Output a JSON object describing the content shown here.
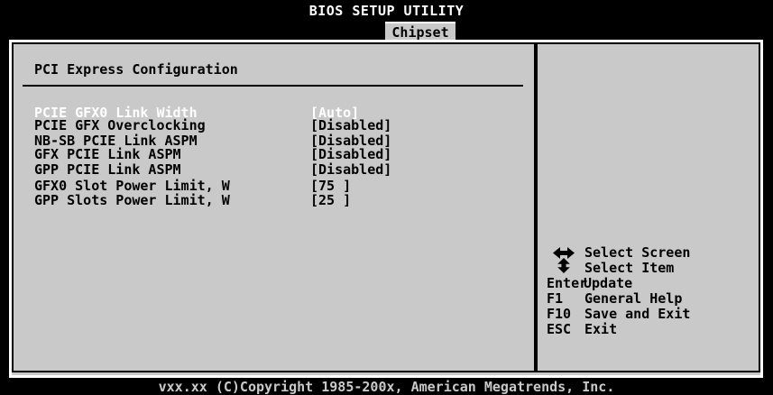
{
  "header": {
    "app_title": "BIOS SETUP UTILITY",
    "active_tab": "Chipset"
  },
  "main": {
    "section_title": "PCI Express Configuration",
    "options": [
      {
        "label": "PCIE GFX0 Link Width",
        "value": "[Auto]",
        "selected": true
      },
      {
        "label": "PCIE GFX Overclocking",
        "value": "[Disabled]",
        "selected": false
      },
      {
        "label": "NB-SB PCIE Link ASPM",
        "value": "[Disabled]",
        "selected": false
      },
      {
        "label": "GFX PCIE Link ASPM",
        "value": "[Disabled]",
        "selected": false
      },
      {
        "label": "GPP PCIE Link ASPM",
        "value": "[Disabled]",
        "selected": false
      },
      {
        "label": "GFX0 Slot Power Limit, W",
        "value": "[75 ]",
        "selected": false
      },
      {
        "label": "GPP Slots Power Limit, W",
        "value": "[25 ]",
        "selected": false
      }
    ]
  },
  "help": {
    "items": [
      {
        "key": "",
        "icon": "left-right-arrows-icon",
        "desc": "Select Screen"
      },
      {
        "key": "",
        "icon": "up-down-arrows-icon",
        "desc": "Select Item"
      },
      {
        "key": "Enter",
        "desc": "Update"
      },
      {
        "key": "F1",
        "desc": "General Help"
      },
      {
        "key": "F10",
        "desc": "Save and Exit"
      },
      {
        "key": "ESC",
        "desc": "Exit"
      }
    ]
  },
  "footer": {
    "copyright": "vxx.xx (C)Copyright 1985-200x, American Megatrends, Inc."
  },
  "colors": {
    "background": "#000000",
    "panel": "#c9c9c9",
    "selected_text": "#ffffff",
    "text": "#000000"
  }
}
